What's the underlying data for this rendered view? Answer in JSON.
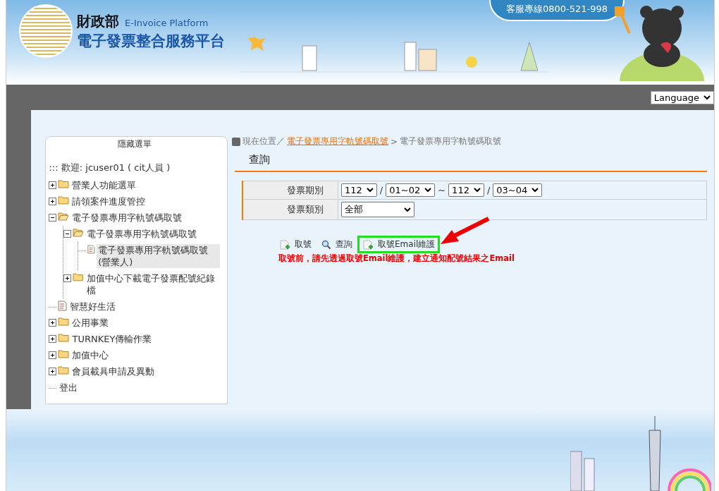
{
  "header": {
    "agency": "財政部",
    "platform_en": "E-Invoice Platform",
    "platform_zh": "電子發票整合服務平台",
    "hotline": "客服專線0800-521-998"
  },
  "language_select": {
    "value": "Language"
  },
  "sidebar": {
    "title": "隱藏選單",
    "welcome": "::: 歡迎: jcuser01 ( cit人員 )",
    "items": [
      {
        "label": "營業人功能選單",
        "kind": "folder",
        "expanded": false,
        "selected": false
      },
      {
        "label": "請領案件進度管控",
        "kind": "folder",
        "expanded": false,
        "selected": false
      },
      {
        "label": "電子發票專用字軌號碼取號",
        "kind": "folder",
        "expanded": true,
        "selected": false,
        "children": [
          {
            "label": "電子發票專用字軌號碼取號",
            "kind": "folder",
            "expanded": true,
            "selected": false,
            "children": [
              {
                "label": "電子發票專用字軌號碼取號(營業人)",
                "kind": "page",
                "selected": true
              }
            ]
          },
          {
            "label": "加值中心下載電子發票配號紀錄檔",
            "kind": "folder",
            "expanded": false,
            "selected": false
          }
        ]
      },
      {
        "label": "智慧好生活",
        "kind": "page",
        "selected": false
      },
      {
        "label": "公用事業",
        "kind": "folder",
        "expanded": false,
        "selected": false
      },
      {
        "label": "TURNKEY傳輸作業",
        "kind": "folder",
        "expanded": false,
        "selected": false
      },
      {
        "label": "加值中心",
        "kind": "folder",
        "expanded": false,
        "selected": false
      },
      {
        "label": "會員載具申請及異動",
        "kind": "folder",
        "expanded": false,
        "selected": false
      },
      {
        "label": "登出",
        "kind": "link",
        "selected": false
      }
    ]
  },
  "breadcrumb": {
    "prefix": "現在位置／",
    "link": "電子發票專用字軌號碼取號",
    "separator": ">",
    "current": "電子發票專用字軌號碼取號"
  },
  "section_title": "查詢",
  "form": {
    "rows": [
      {
        "label": "發票期別",
        "fields": [
          {
            "kind": "select",
            "value": "112"
          },
          {
            "kind": "sep",
            "text": "/"
          },
          {
            "kind": "select",
            "value": "01~02"
          },
          {
            "kind": "sep",
            "text": "~"
          },
          {
            "kind": "select",
            "value": "112"
          },
          {
            "kind": "sep",
            "text": "/"
          },
          {
            "kind": "select",
            "value": "03~04"
          }
        ]
      },
      {
        "label": "發票類別",
        "fields": [
          {
            "kind": "select",
            "value": "全部"
          }
        ]
      }
    ]
  },
  "actions": [
    {
      "label": "取號",
      "kind": "page",
      "highlighted": false
    },
    {
      "label": "查詢",
      "kind": "search",
      "highlighted": false
    },
    {
      "label": "取號Email維護",
      "kind": "page",
      "highlighted": true
    }
  ],
  "notice": "取號前，請先透過取號Email維護，建立通知配號結果之Email"
}
